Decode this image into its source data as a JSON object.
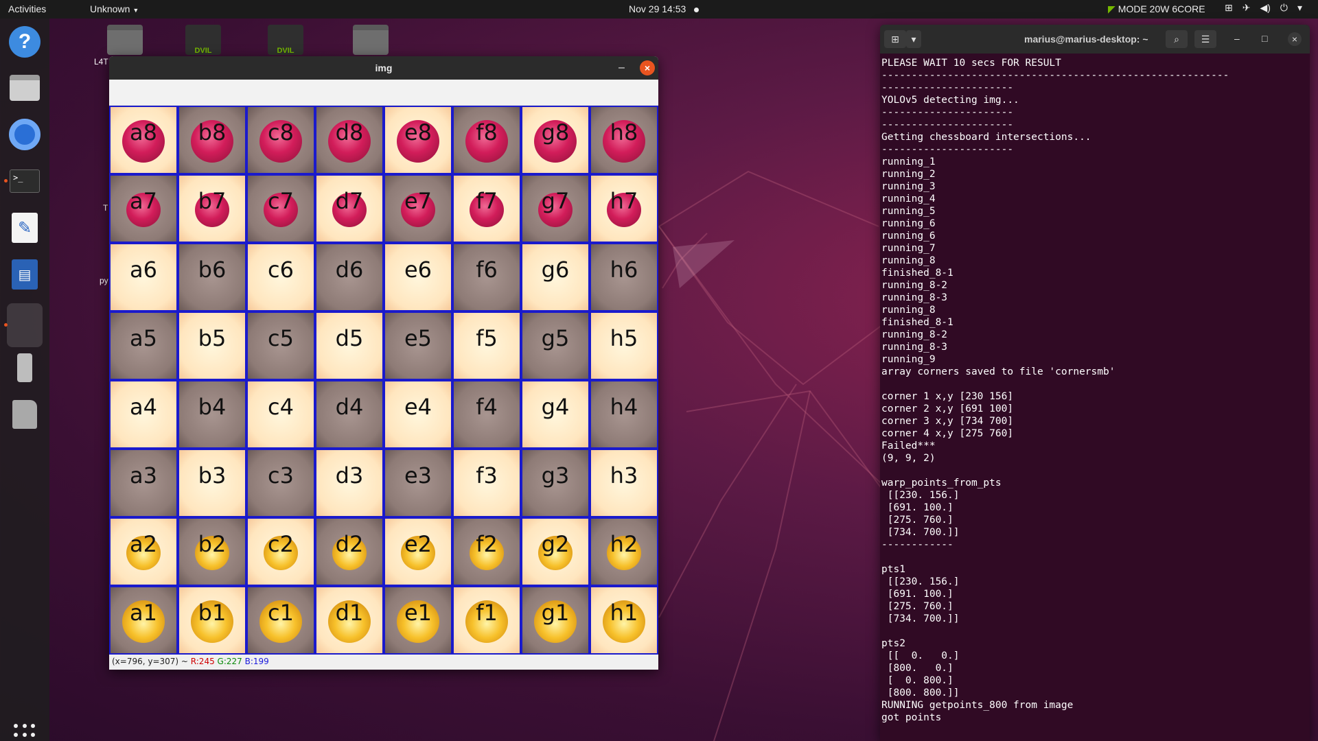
{
  "topbar": {
    "activities": "Activities",
    "app_menu": "Unknown",
    "clock": "Nov 29  14:53",
    "mode": "MODE 20W 6CORE",
    "tray_icons": [
      "network-icon",
      "airplane-icon",
      "volume-icon",
      "power-icon",
      "chevron-down-icon"
    ]
  },
  "dock": {
    "items": [
      {
        "name": "help-icon"
      },
      {
        "name": "files-icon"
      },
      {
        "name": "chromium-icon"
      },
      {
        "name": "terminal-icon"
      },
      {
        "name": "text-editor-icon"
      },
      {
        "name": "writer-icon"
      },
      {
        "name": "active-window-icon"
      },
      {
        "name": "usb-drive-icon"
      },
      {
        "name": "sd-card-icon"
      },
      {
        "name": "show-apps-icon"
      }
    ]
  },
  "desktop": {
    "labels": [
      "L4T",
      "T",
      "py"
    ],
    "nvidia_labels": [
      "DVIL",
      "DVIL"
    ]
  },
  "img_window": {
    "title": "img",
    "status": {
      "coords": "(x=796, y=307) ~ ",
      "r": "R:245",
      "g": "G:227",
      "b": "B:199"
    },
    "board": {
      "rows": [
        [
          "a8",
          "b8",
          "c8",
          "d8",
          "e8",
          "f8",
          "g8",
          "h8"
        ],
        [
          "a7",
          "b7",
          "c7",
          "d7",
          "e7",
          "f7",
          "g7",
          "h7"
        ],
        [
          "a6",
          "b6",
          "c6",
          "d6",
          "e6",
          "f6",
          "g6",
          "h6"
        ],
        [
          "a5",
          "b5",
          "c5",
          "d5",
          "e5",
          "f5",
          "g5",
          "h5"
        ],
        [
          "a4",
          "b4",
          "c4",
          "d4",
          "e4",
          "f4",
          "g4",
          "h4"
        ],
        [
          "a3",
          "b3",
          "c3",
          "d3",
          "e3",
          "f3",
          "g3",
          "h3"
        ],
        [
          "a2",
          "b2",
          "c2",
          "d2",
          "e2",
          "f2",
          "g2",
          "h2"
        ],
        [
          "a1",
          "b1",
          "c1",
          "d1",
          "e1",
          "f1",
          "g1",
          "h1"
        ]
      ],
      "shades": [
        [
          "light",
          "dark",
          "dark",
          "dark",
          "light",
          "dark",
          "light",
          "dark"
        ],
        [
          "dark",
          "light",
          "dark",
          "light",
          "dark",
          "light",
          "dark",
          "light"
        ],
        [
          "light",
          "dark",
          "light",
          "dark",
          "light",
          "dark",
          "light",
          "dark"
        ],
        [
          "dark",
          "light",
          "dark",
          "light",
          "dark",
          "light",
          "dark",
          "light"
        ],
        [
          "light",
          "dark",
          "light",
          "dark",
          "light",
          "dark",
          "light",
          "dark"
        ],
        [
          "dark",
          "light",
          "dark",
          "light",
          "dark",
          "light",
          "dark",
          "light"
        ],
        [
          "light",
          "dark",
          "light",
          "dark",
          "light",
          "dark",
          "light",
          "dark"
        ],
        [
          "dark",
          "light",
          "dark",
          "light",
          "dark",
          "light",
          "dark",
          "light"
        ]
      ],
      "pieces": {
        "8": "red",
        "7": "red-small",
        "2": "yellow-small",
        "1": "yellow"
      }
    }
  },
  "terminal": {
    "title": "marius@marius-desktop: ~",
    "lines": [
      "PLEASE WAIT 10 secs FOR RESULT",
      "----------------------------------------------------------",
      "----------------------",
      "YOLOv5 detecting img...",
      "----------------------",
      "----------------------",
      "Getting chessboard intersections...",
      "----------------------",
      "running_1",
      "running_2",
      "running_3",
      "running_4",
      "running_5",
      "running_6",
      "running_6",
      "running_7",
      "running_8",
      "finished_8-1",
      "running_8-2",
      "running_8-3",
      "running_8",
      "finished_8-1",
      "running_8-2",
      "running_8-3",
      "running_9",
      "array corners saved to file 'cornersmb'",
      "",
      "corner 1 x,y [230 156]",
      "corner 2 x,y [691 100]",
      "corner 3 x,y [734 700]",
      "corner 4 x,y [275 760]",
      "Failed***",
      "(9, 9, 2)",
      "",
      "warp_points_from_pts",
      " [[230. 156.]",
      " [691. 100.]",
      " [275. 760.]",
      " [734. 700.]]",
      "------------",
      "",
      "pts1",
      " [[230. 156.]",
      " [691. 100.]",
      " [275. 760.]",
      " [734. 700.]]",
      "",
      "pts2",
      " [[  0.   0.]",
      " [800.   0.]",
      " [  0. 800.]",
      " [800. 800.]]",
      "RUNNING getpoints_800 from image",
      "got points"
    ]
  },
  "colors": {
    "accent": "#e95420",
    "terminal_bg": "#300a24",
    "board_grid": "#1a1aff",
    "nvidia_green": "#76b900"
  }
}
